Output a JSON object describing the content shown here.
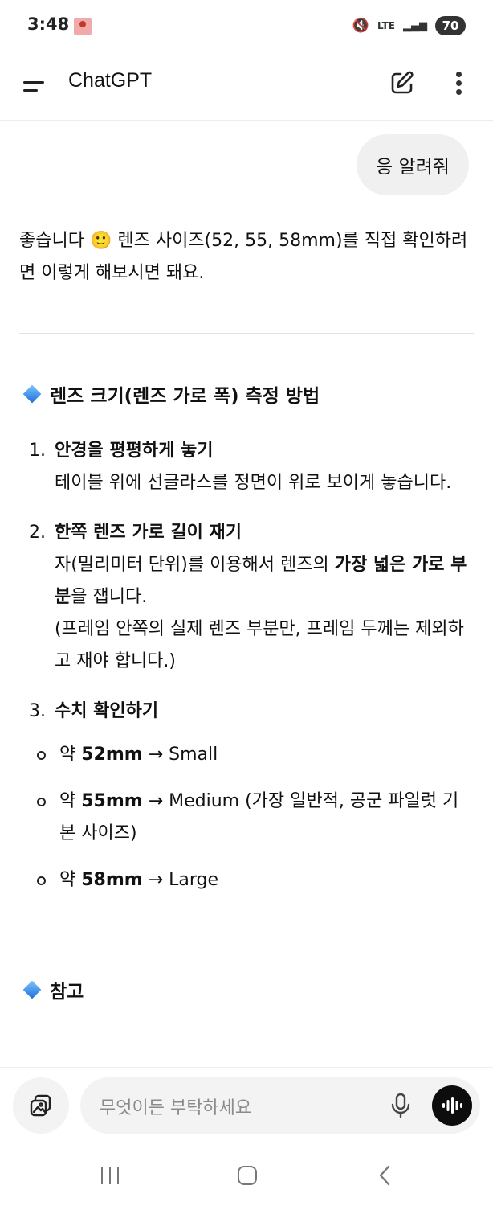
{
  "status_bar": {
    "time": "3:48",
    "network_label": "LTE",
    "battery": "70",
    "mute_glyph": "🔇",
    "signal_glyph": "▂▄▆"
  },
  "header": {
    "title": "ChatGPT",
    "menu_icon": "menu-icon",
    "new_chat_icon": "edit-icon",
    "more_icon": "more-vertical-icon"
  },
  "conversation": {
    "user_message": "응 알려줘",
    "assistant": {
      "intro_before_emoji": "좋습니다 ",
      "intro_emoji": "🙂",
      "intro_after_emoji": " 렌즈 사이즈(52, 55, 58mm)를 직접 확인하려면 이렇게 해보시면 돼요.",
      "section1_title": "렌즈 크기(렌즈 가로 폭) 측정 방법",
      "steps": [
        {
          "number": "1.",
          "title": "안경을 평평하게 놓기",
          "body": "테이블 위에 선글라스를 정면이 위로 보이게 놓습니다."
        },
        {
          "number": "2.",
          "title": "한쪽 렌즈 가로 길이 재기",
          "body_before_bold": "자(밀리미터 단위)를 이용해서 렌즈의 ",
          "body_bold": "가장 넓은 가로 부분",
          "body_after_bold": "을 잽니다.",
          "body_note": "(프레임 안쪽의 실제 렌즈 부분만, 프레임 두께는 제외하고 재야 합니다.)"
        },
        {
          "number": "3.",
          "title": "수치 확인하기",
          "sizes": [
            {
              "prefix": "약 ",
              "value": "52mm",
              "suffix": " → Small"
            },
            {
              "prefix": "약 ",
              "value": "55mm",
              "suffix": " → Medium (가장 일반적, 공군 파일럿 기본 사이즈)"
            },
            {
              "prefix": "약 ",
              "value": "58mm",
              "suffix": " → Large"
            }
          ]
        }
      ],
      "section2_title": "참고"
    }
  },
  "composer": {
    "placeholder": "무엇이든 부탁하세요",
    "attach_icon": "image-attach-icon",
    "mic_icon": "microphone-icon",
    "voice_icon": "voice-mode-icon"
  },
  "nav_bar": {
    "recents_icon": "recents-icon",
    "home_icon": "home-icon",
    "back_icon": "back-icon"
  },
  "colors": {
    "bubble_bg": "#f0f0f0",
    "diamond_blue": "#1e6fd9",
    "voice_button": "#0d0d0d"
  }
}
